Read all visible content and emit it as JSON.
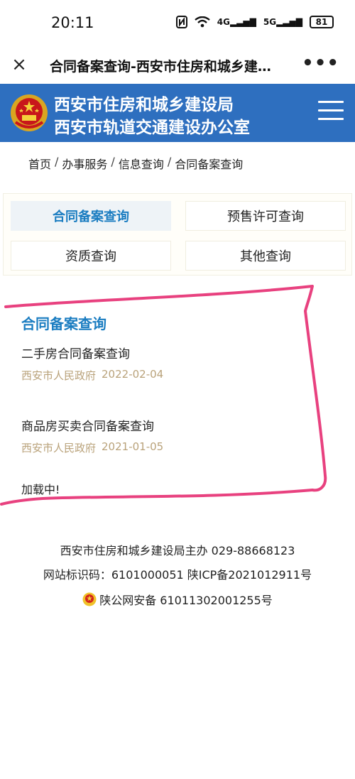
{
  "status_bar": {
    "time": "20:11",
    "signal1": "4G",
    "signal2": "5G",
    "battery": "81",
    "icons": [
      "nfc-icon",
      "wifi-icon",
      "signal-icon",
      "battery-icon"
    ]
  },
  "browser": {
    "title": "合同备案查询-西安市住房和城乡建…",
    "close_icon": "×",
    "more_icon": "•••"
  },
  "site_header": {
    "line1": "西安市住房和城乡建设局",
    "line2": "西安市轨道交通建设办公室",
    "colors": {
      "background": "#2e6fbf",
      "text": "#ffffff"
    }
  },
  "breadcrumb": [
    "首页",
    "办事服务",
    "信息查询",
    "合同备案查询"
  ],
  "tabs": [
    {
      "label": "合同备案查询",
      "active": true
    },
    {
      "label": "预售许可查询",
      "active": false
    },
    {
      "label": "资质查询",
      "active": false
    },
    {
      "label": "其他查询",
      "active": false
    }
  ],
  "results": {
    "section_title": "合同备案查询",
    "items": [
      {
        "title": "二手房合同备案查询",
        "source": "西安市人民政府",
        "date": "2022-02-04"
      },
      {
        "title": "商品房买卖合同备案查询",
        "source": "西安市人民政府",
        "date": "2021-01-05"
      }
    ],
    "loading_text": "加载中!"
  },
  "footer": {
    "line1": "西安市住房和城乡建设局主办 029-88668123",
    "line2": "网站标识码：6101000051 陕ICP备2021012911号",
    "line3": "陕公网安备 61011302001255号"
  },
  "colors": {
    "accent": "#1b7dc1",
    "meta": "#b9a27a",
    "annotation": "#e8417f"
  }
}
